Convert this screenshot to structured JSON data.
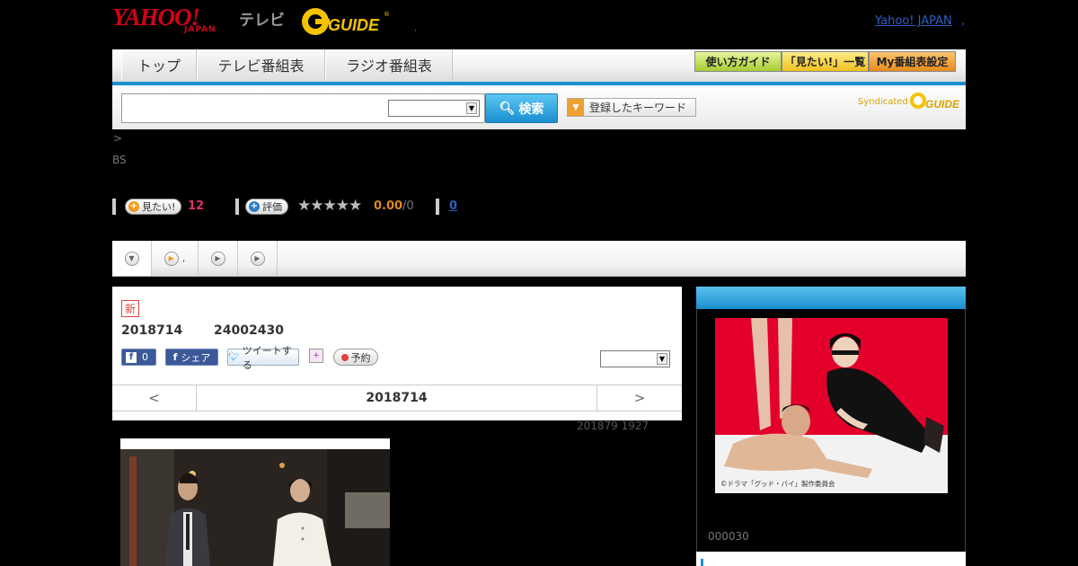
{
  "header": {
    "logo_main": "YAHOO!",
    "logo_sub": "JAPAN",
    "logo_tv": "テレビ",
    "gguide_logo": "GUIDE",
    "dot": ",",
    "yahoo_japan_link": "Yahoo! JAPAN",
    "trailing_dot": ","
  },
  "nav": {
    "tabs": [
      "トップ",
      "テレビ番組表",
      "ラジオ番組表"
    ],
    "guide_buttons": [
      {
        "label": "使い方ガイド",
        "color": "#c9e36a"
      },
      {
        "label": "「見たい!」一覧",
        "color": "#f7d24a"
      },
      {
        "label": "My番組表設定",
        "color": "#f3a13a"
      }
    ],
    "accent": "#1a8fd0"
  },
  "search": {
    "input_value": "",
    "select_value": "",
    "button_label": "検索",
    "keyword_button_label": "登録したキーワード",
    "syndicated_label": "Syndicated",
    "syndicated_logo": "GUIDE"
  },
  "breadcrumb": ">",
  "channel": "BS",
  "rating": {
    "want_label": "見たい!",
    "want_count": "12",
    "rate_label": "評価",
    "stars_filled": 0,
    "stars_total": 5,
    "score": "0.00",
    "score_count": "/0",
    "reviews_count": "0"
  },
  "subtabs": [
    {
      "label": ""
    },
    {
      "label": ","
    },
    {
      "label": ""
    },
    {
      "label": ""
    }
  ],
  "program": {
    "new_badge": "新",
    "date": "2018714",
    "time": "24002430",
    "fb_count": "0",
    "share_label": "シェア",
    "tweet_label": "ツイートする",
    "reserve_label": "予約",
    "select_value": "",
    "prev": "<",
    "current_date": "2018714",
    "next": ">",
    "note": "201879  1927"
  },
  "poster": {
    "credit": "©ドラマ「グッド・バイ」製作委員会",
    "caption": "000030"
  }
}
